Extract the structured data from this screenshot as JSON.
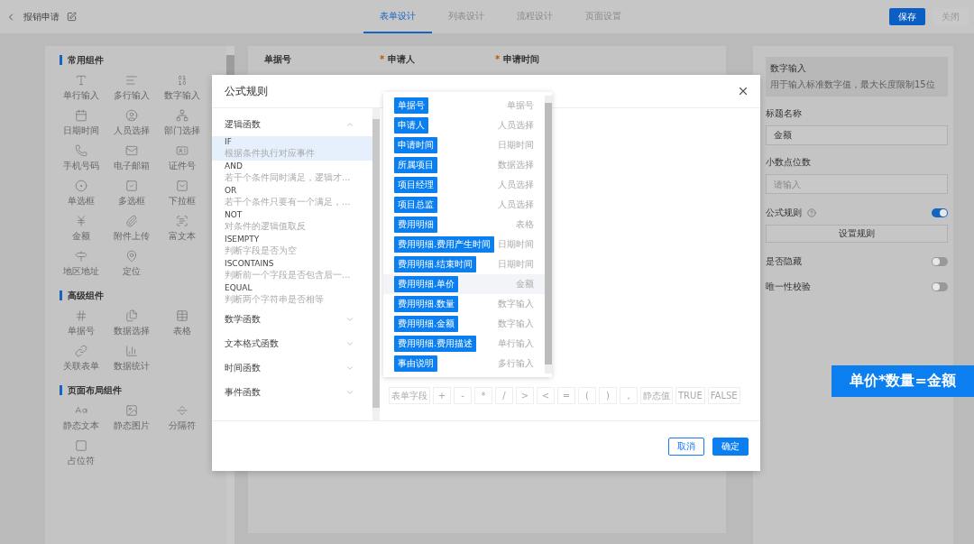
{
  "header": {
    "title": "报销申请",
    "tabs": [
      {
        "label": "表单设计",
        "selected": true
      },
      {
        "label": "列表设计",
        "selected": false
      },
      {
        "label": "流程设计",
        "selected": false
      },
      {
        "label": "页面设置",
        "selected": false
      }
    ],
    "buttons": [
      {
        "label": "保存",
        "kind": "primary"
      },
      {
        "label": "关闭",
        "kind": "secondary"
      }
    ]
  },
  "palette": {
    "sections": [
      {
        "title": "常用组件",
        "items": [
          "单行输入",
          "多行输入",
          "数字输入",
          "日期时间",
          "人员选择",
          "部门选择",
          "手机号码",
          "电子邮箱",
          "证件号",
          "单选框",
          "多选框",
          "下拉框",
          "金额",
          "附件上传",
          "富文本",
          "地区地址",
          "定位"
        ]
      },
      {
        "title": "高级组件",
        "items": [
          "单据号",
          "数据选择",
          "表格",
          "关联表单",
          "数据统计"
        ]
      },
      {
        "title": "页面布局组件",
        "items": [
          "静态文本",
          "静态图片",
          "分隔符",
          "占位符"
        ]
      }
    ]
  },
  "canvas": {
    "fields": [
      {
        "label": "单据号",
        "required": false
      },
      {
        "label": "申请人",
        "required": true
      },
      {
        "label": "申请时间",
        "required": true
      }
    ]
  },
  "properties": {
    "card": {
      "title": "数字输入",
      "description": "用于输入标准数字值，最大长度限制15位"
    },
    "title_label": "标题名称",
    "title_value": "金额",
    "decimal_label": "小数点位数",
    "decimal_placeholder": "请输入",
    "switches": [
      {
        "label": "公式规则",
        "on": true,
        "help": true
      },
      {
        "label": "是否隐藏",
        "on": false,
        "help": false
      },
      {
        "label": "唯一性校验",
        "on": false,
        "help": false
      }
    ],
    "rule_button": "设置规则"
  },
  "dialog": {
    "title": "公式规则",
    "categories": [
      {
        "name": "逻辑函数",
        "expanded": true,
        "functions": [
          {
            "name": "IF",
            "description": "根据条件执行对应事件",
            "selected": true
          },
          {
            "name": "AND",
            "description": "若干个条件同时满足，逻辑才...",
            "selected": false
          },
          {
            "name": "OR",
            "description": "若干个条件只要有一个满足，...",
            "selected": false
          },
          {
            "name": "NOT",
            "description": "对条件的逻辑值取反",
            "selected": false
          },
          {
            "name": "ISEMPTY",
            "description": "判断字段是否为空",
            "selected": false
          },
          {
            "name": "ISCONTAINS",
            "description": "判断前一个字段是否包含后一...",
            "selected": false
          },
          {
            "name": "EQUAL",
            "description": "判断两个字符串是否相等",
            "selected": false
          }
        ]
      },
      {
        "name": "数学函数",
        "expanded": false
      },
      {
        "name": "文本格式函数",
        "expanded": false
      },
      {
        "name": "时间函数",
        "expanded": false
      },
      {
        "name": "事件函数",
        "expanded": false
      }
    ],
    "field_menu": [
      {
        "field": "单据号",
        "type": "单据号",
        "hovered": false
      },
      {
        "field": "申请人",
        "type": "人员选择",
        "hovered": false
      },
      {
        "field": "申请时间",
        "type": "日期时间",
        "hovered": false
      },
      {
        "field": "所属项目",
        "type": "数据选择",
        "hovered": false
      },
      {
        "field": "项目经理",
        "type": "人员选择",
        "hovered": false
      },
      {
        "field": "项目总监",
        "type": "人员选择",
        "hovered": false
      },
      {
        "field": "费用明细",
        "type": "表格",
        "hovered": false
      },
      {
        "field": "费用明细.费用产生时间",
        "type": "日期时间",
        "hovered": false
      },
      {
        "field": "费用明细.结束时间",
        "type": "日期时间",
        "hovered": false
      },
      {
        "field": "费用明细.单价",
        "type": "金额",
        "hovered": true
      },
      {
        "field": "费用明细.数量",
        "type": "数字输入",
        "hovered": false
      },
      {
        "field": "费用明细.金额",
        "type": "数字输入",
        "hovered": false
      },
      {
        "field": "费用明细.费用描述",
        "type": "单行输入",
        "hovered": false
      },
      {
        "field": "事由说明",
        "type": "多行输入",
        "hovered": false
      }
    ],
    "operators": [
      "表单字段",
      "+",
      "-",
      "*",
      "/",
      ">",
      "<",
      "=",
      "(",
      ")",
      ",",
      "静态值",
      "TRUE",
      "FALSE"
    ],
    "buttons": [
      {
        "label": "取消",
        "kind": "secondary"
      },
      {
        "label": "确定",
        "kind": "primary"
      }
    ]
  },
  "callout": "单价*数量=金额"
}
